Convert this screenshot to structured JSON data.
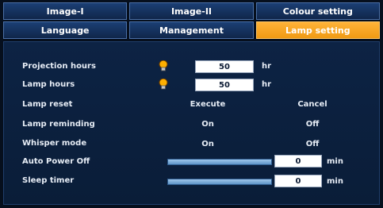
{
  "tabs_row1": [
    "Image-I",
    "Image-II",
    "Colour setting"
  ],
  "tabs_row2": [
    "Language",
    "Management",
    "Lamp setting"
  ],
  "settings": {
    "projection_hours": {
      "label": "Projection hours",
      "value": "50",
      "unit": "hr"
    },
    "lamp_hours": {
      "label": "Lamp hours",
      "value": "50",
      "unit": "hr"
    },
    "lamp_reset": {
      "label": "Lamp reset",
      "option1": "Execute",
      "option2": "Cancel"
    },
    "lamp_reminding": {
      "label": "Lamp reminding",
      "option1": "On",
      "option2": "Off"
    },
    "whisper_mode": {
      "label": "Whisper mode",
      "option1": "On",
      "option2": "Off"
    },
    "auto_power_off": {
      "label": "Auto Power Off",
      "value": "0",
      "unit": "min"
    },
    "sleep_timer": {
      "label": "Sleep timer",
      "value": "0",
      "unit": "min"
    }
  },
  "icons": {
    "lamp": "lamp-bulb-icon"
  },
  "colors": {
    "active_tab": "#f5a623",
    "tab": "#143461",
    "background": "#0a1d38"
  }
}
